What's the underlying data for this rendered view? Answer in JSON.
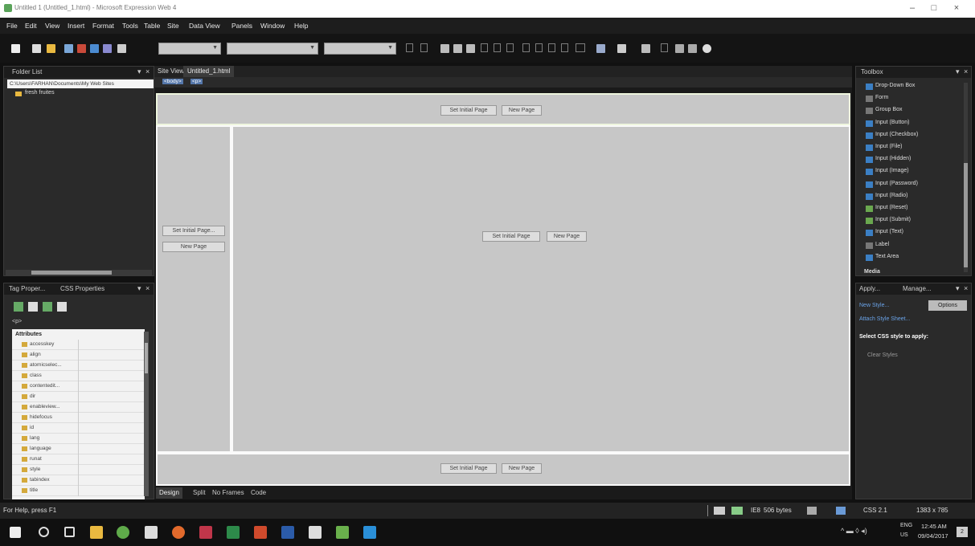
{
  "window": {
    "title": "Untitled 1 (Untitled_1.html) - Microsoft Expression Web 4",
    "min_label": "–",
    "max_label": "□",
    "close_label": "×"
  },
  "menu": [
    "File",
    "Edit",
    "View",
    "Insert",
    "Format",
    "Tools",
    "Table",
    "Site",
    "Data View",
    "Panels",
    "Window",
    "Help"
  ],
  "folder_list": {
    "title": "Folder List",
    "path": "C:\\Users\\FARHAN\\Documents\\My Web Sites",
    "items": [
      "fresh fruites"
    ]
  },
  "tag_properties": {
    "tabs": [
      "Tag Proper...",
      "CSS Properties"
    ],
    "tag": "<p>",
    "section": "Attributes",
    "attributes": [
      "accesskey",
      "align",
      "atomicselec...",
      "class",
      "contentedit...",
      "dir",
      "enableview...",
      "hidefocus",
      "id",
      "lang",
      "language",
      "runat",
      "style",
      "tabindex",
      "title"
    ]
  },
  "editor": {
    "tabs": [
      "Site View",
      "Untitled_1.html"
    ],
    "breadcrumbs": [
      "<body>",
      "<p>"
    ],
    "frames": {
      "top": {
        "set_initial": "Set Initial Page",
        "new_page": "New Page"
      },
      "left": {
        "set_initial": "Set Initial Page...",
        "new_page": "New Page"
      },
      "main": {
        "set_initial": "Set Initial Page",
        "new_page": "New Page"
      },
      "bottom": {
        "set_initial": "Set Initial Page",
        "new_page": "New Page"
      }
    },
    "view_tabs": [
      "Design",
      "Split",
      "No Frames",
      "Code"
    ]
  },
  "toolbox": {
    "title": "Toolbox",
    "items": [
      "Drop-Down Box",
      "Form",
      "Group Box",
      "Input (Button)",
      "Input (Checkbox)",
      "Input (File)",
      "Input (Hidden)",
      "Input (Image)",
      "Input (Password)",
      "Input (Radio)",
      "Input (Reset)",
      "Input (Submit)",
      "Input (Text)",
      "Label",
      "Text Area"
    ],
    "media_section": "Media"
  },
  "apply_styles": {
    "tabs": [
      "Apply...",
      "Manage..."
    ],
    "new_style": "New Style...",
    "options": "Options",
    "attach": "Attach Style Sheet...",
    "select_label": "Select CSS style to apply:",
    "clear": "Clear Styles"
  },
  "status": {
    "help": "For Help, press F1",
    "browser": "IE8",
    "size": "506 bytes",
    "css": "CSS 2.1",
    "resolution": "1383 x 785"
  },
  "taskbar": {
    "lang_top": "ENG",
    "lang_bottom": "US",
    "time": "12:45 AM",
    "date": "09/04/2017",
    "notifications": "2"
  },
  "colors": {
    "frame_bg": "#c7c7c7",
    "panel_bg": "#2a2a2a",
    "chrome_bg": "#1d1d1d",
    "accent": "#3b7fc4"
  }
}
